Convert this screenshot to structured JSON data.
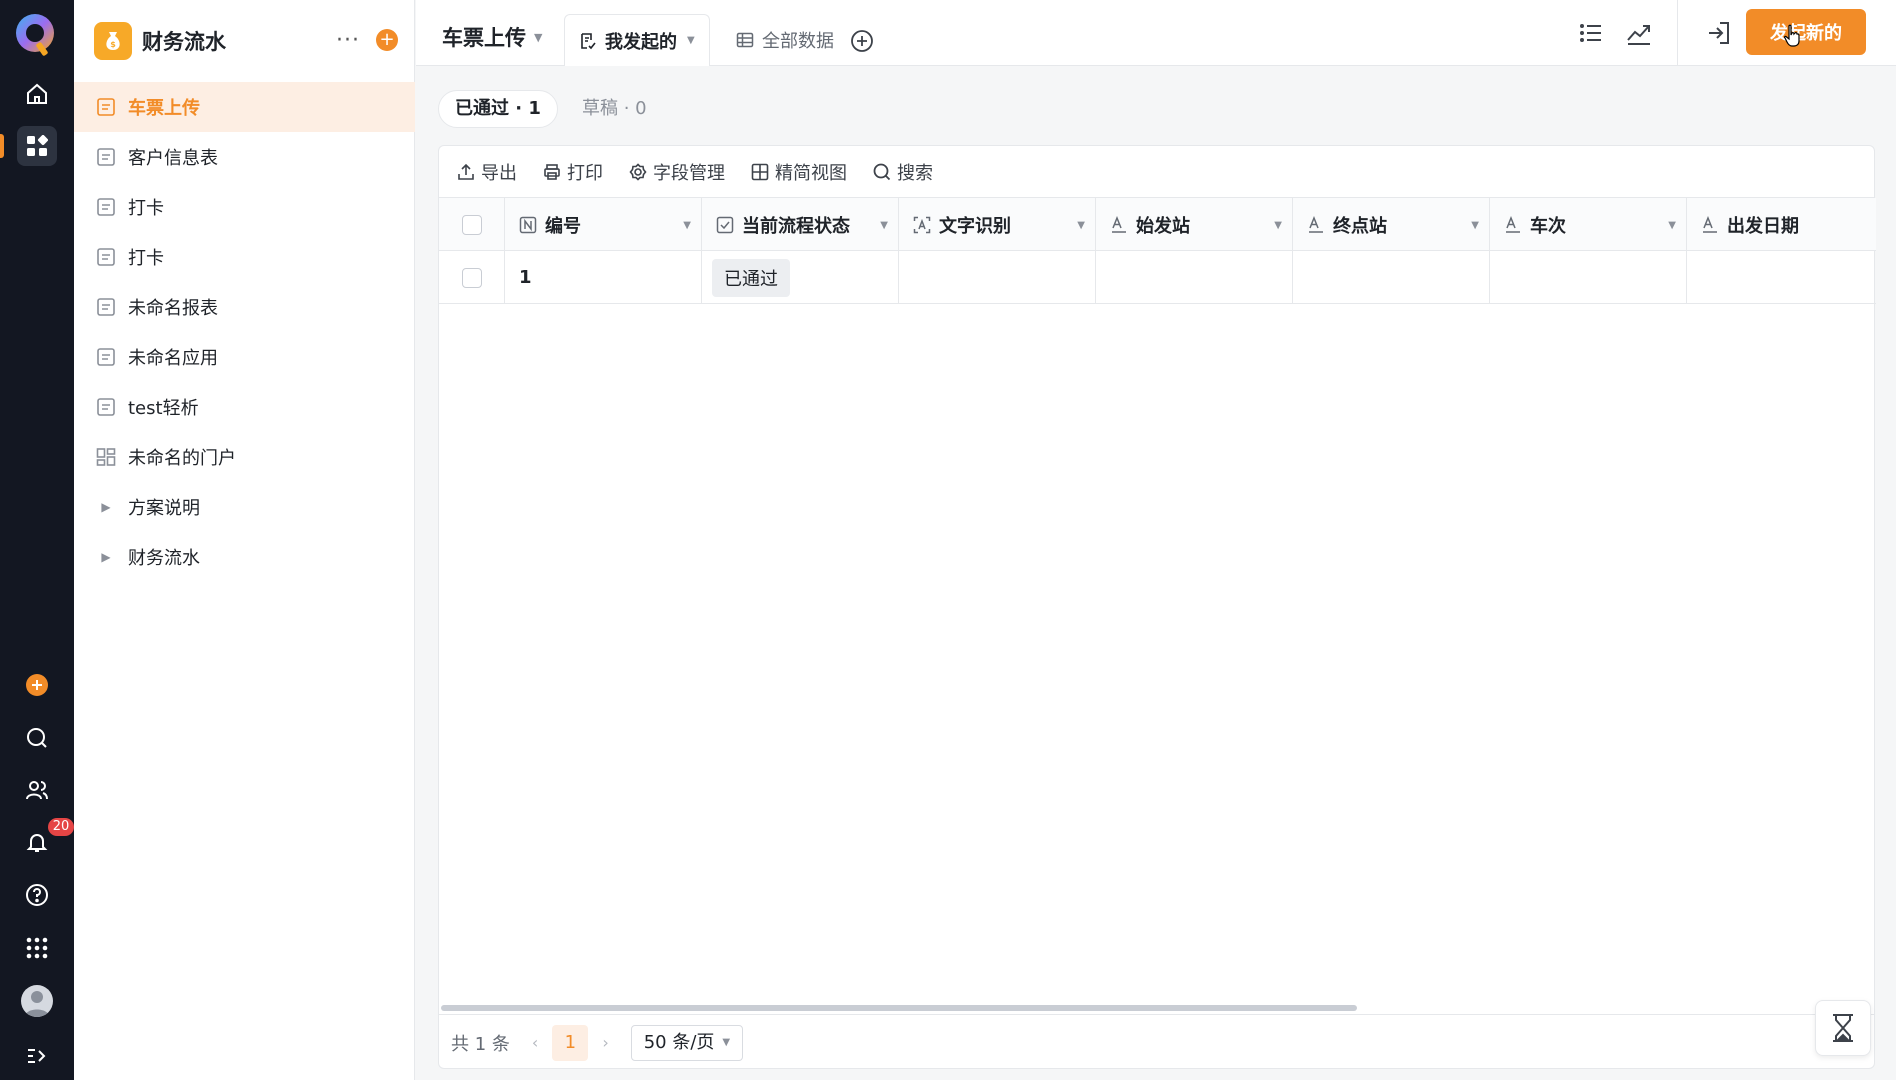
{
  "colors": {
    "accent": "#f28c28",
    "rail_bg": "#131722",
    "badge": "#e54545"
  },
  "rail": {
    "logo": "Q",
    "notification_count": "20",
    "icons": [
      "home-icon",
      "apps-grid-icon",
      "add-circle-icon",
      "search-icon",
      "contacts-icon",
      "bell-icon",
      "help-icon",
      "app-launcher-icon",
      "avatar",
      "expand-icon"
    ]
  },
  "sidebar": {
    "app_title": "财务流水",
    "more_label": "···",
    "add_label": "+",
    "items": [
      {
        "label": "车票上传",
        "type": "form",
        "active": true
      },
      {
        "label": "客户信息表",
        "type": "form"
      },
      {
        "label": "打卡",
        "type": "form"
      },
      {
        "label": "打卡",
        "type": "form"
      },
      {
        "label": "未命名报表",
        "type": "form"
      },
      {
        "label": "未命名应用",
        "type": "form"
      },
      {
        "label": "test轻析",
        "type": "form"
      },
      {
        "label": "未命名的门户",
        "type": "portal"
      },
      {
        "label": "方案说明",
        "type": "folder"
      },
      {
        "label": "财务流水",
        "type": "folder"
      }
    ]
  },
  "topbar": {
    "title": "车票上传",
    "tabs": [
      {
        "label": "我发起的",
        "active": true
      },
      {
        "label": "全部数据",
        "active": false
      }
    ],
    "primary_button": "发起新的"
  },
  "status_filters": [
    {
      "label": "已通过 · 1",
      "active": true
    },
    {
      "label": "草稿 · 0",
      "active": false
    }
  ],
  "toolbar": {
    "export": "导出",
    "print": "打印",
    "fields": "字段管理",
    "compact_view": "精简视图",
    "search": "搜索"
  },
  "table": {
    "columns": [
      "编号",
      "当前流程状态",
      "文字识别",
      "始发站",
      "终点站",
      "车次",
      "出发日期"
    ],
    "rows": [
      {
        "id": "1",
        "status": "已通过",
        "ocr": "",
        "from": "",
        "to": "",
        "train": "",
        "date": ""
      }
    ]
  },
  "pager": {
    "total": "共 1 条",
    "current_page": "1",
    "page_size": "50 条/页"
  }
}
